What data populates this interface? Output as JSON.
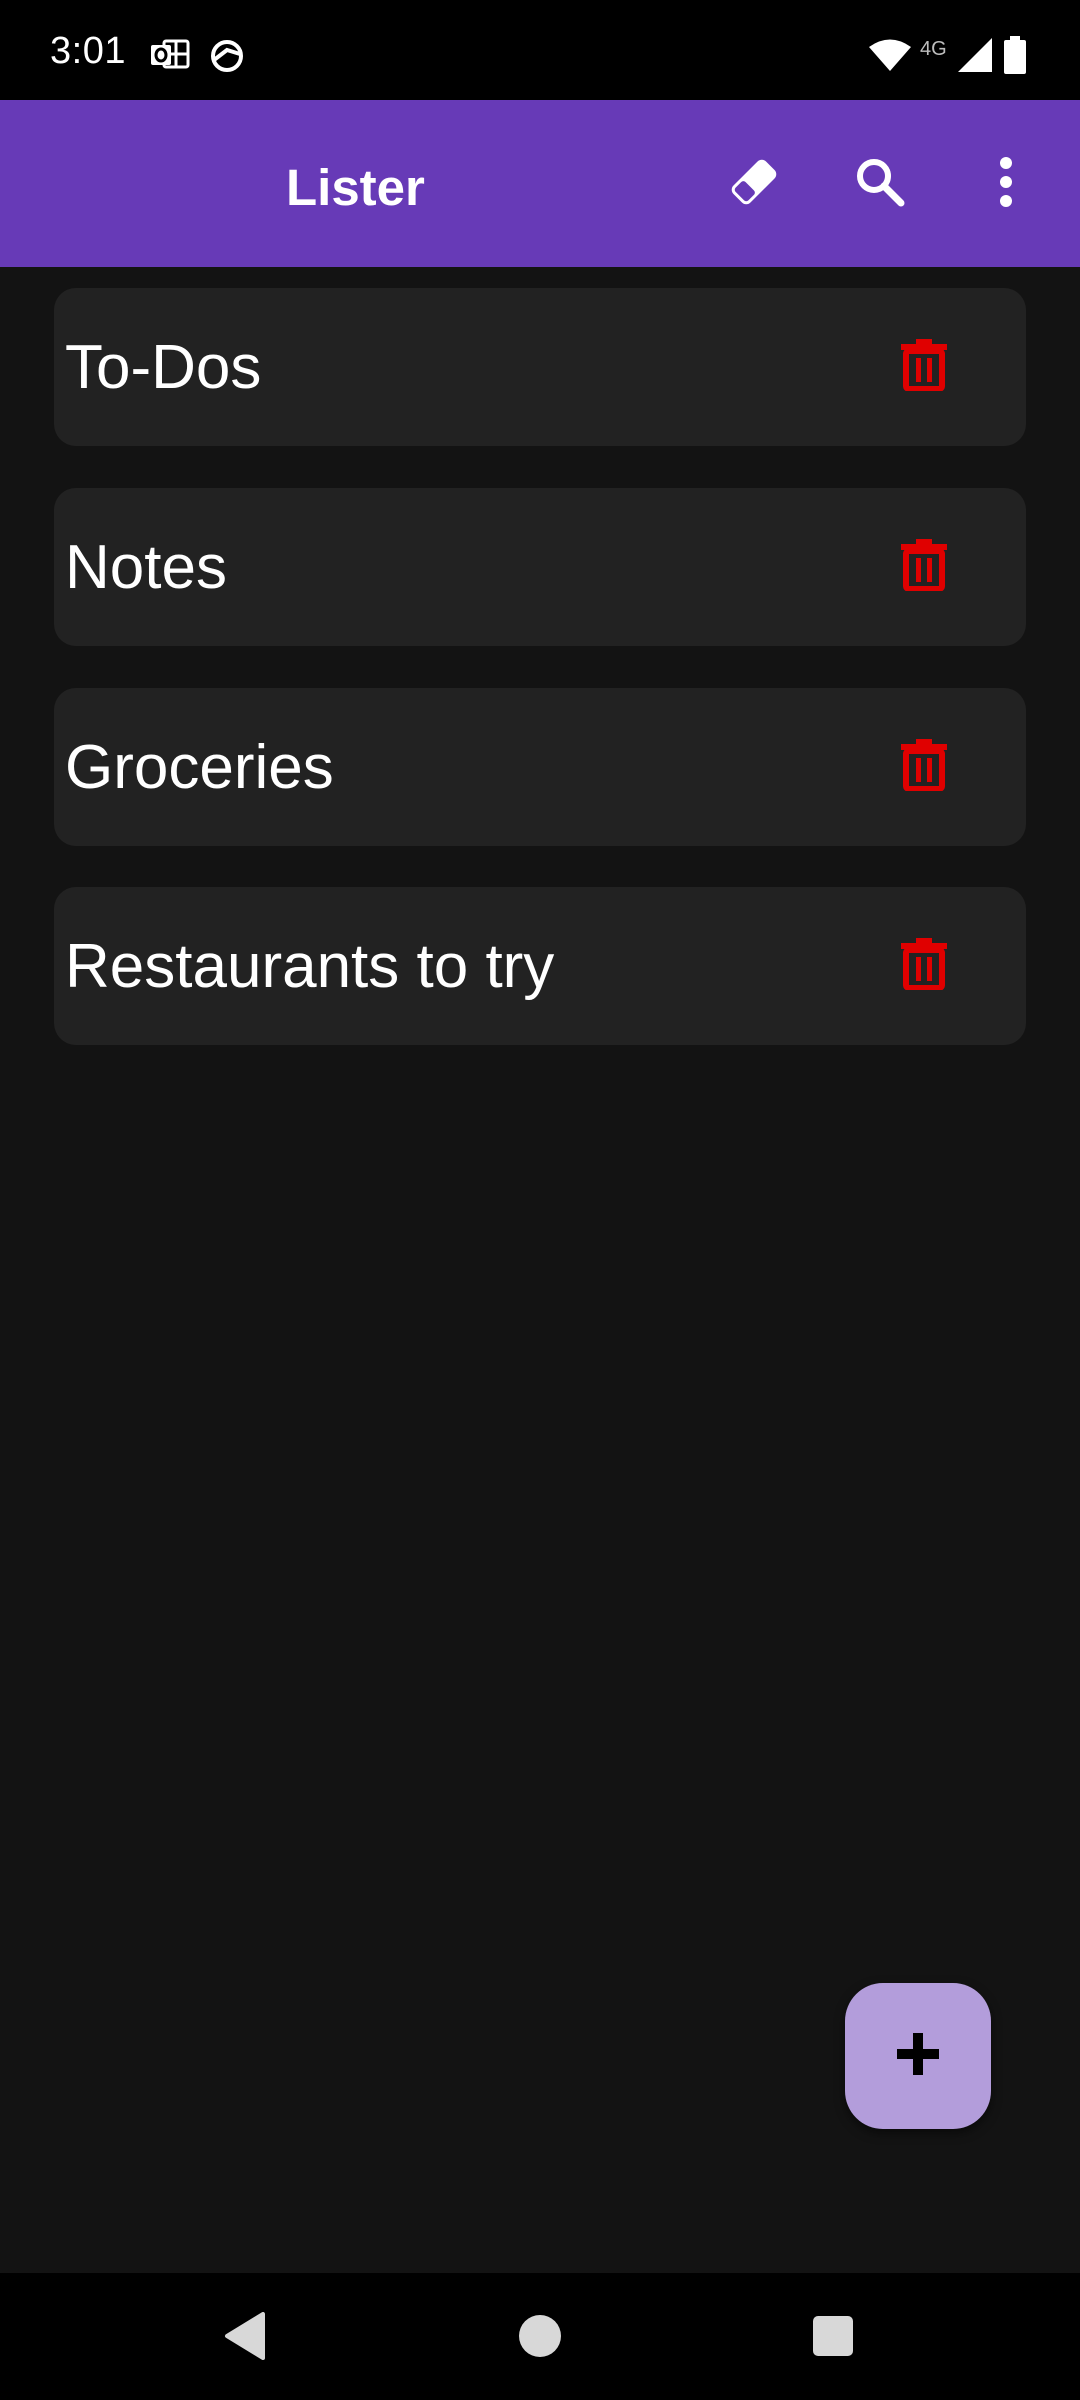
{
  "status_bar": {
    "time": "3:01",
    "network_label": "4G",
    "icons": [
      "outlook-icon",
      "vpn-icon",
      "wifi-icon",
      "signal-icon",
      "battery-icon"
    ]
  },
  "app_bar": {
    "title": "Lister",
    "actions": [
      "eraser-icon",
      "search-icon",
      "more-vert-icon"
    ],
    "color": "#673ab7"
  },
  "lists": [
    {
      "label": "To-Dos"
    },
    {
      "label": "Notes"
    },
    {
      "label": "Groceries"
    },
    {
      "label": "Restaurants to try"
    }
  ],
  "colors": {
    "background": "#131313",
    "card": "#222222",
    "delete_icon": "#e00000",
    "fab": "#b39ddb"
  },
  "fab": {
    "icon": "plus-icon"
  },
  "nav_bar": {
    "buttons": [
      "back-icon",
      "home-icon",
      "recents-icon"
    ]
  }
}
